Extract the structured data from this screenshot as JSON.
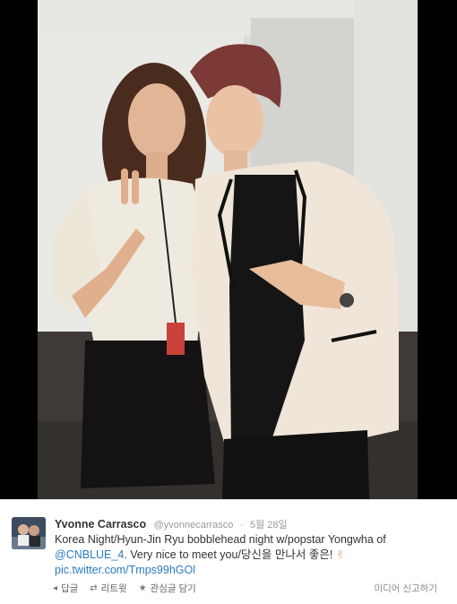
{
  "tweet": {
    "display_name": "Yvonne Carrasco",
    "handle": "@yvonnecarrasco",
    "separator": "·",
    "date": "5월 28일",
    "text_line1": "Korea Night/Hyun-Jin Ryu bobblehead night w/popstar Yongwha of",
    "mention": "@CNBLUE_4",
    "text_line2_rest": ". Very nice to meet you/당신을 만나서 좋은!",
    "emoji": "✌",
    "pic_link": "pic.twitter.com/Tmps99hGOl",
    "actions": [
      {
        "icon": "reply-icon",
        "glyph": "◂",
        "label": "답글"
      },
      {
        "icon": "retweet-icon",
        "glyph": "⇄",
        "label": "리트윗"
      },
      {
        "icon": "favorite-star-icon",
        "glyph": "★",
        "label": "관심글 담기"
      }
    ],
    "report_label": "미디어 신고하기"
  },
  "colors": {
    "link": "#2a7bbf",
    "photo_border": "#000000"
  }
}
